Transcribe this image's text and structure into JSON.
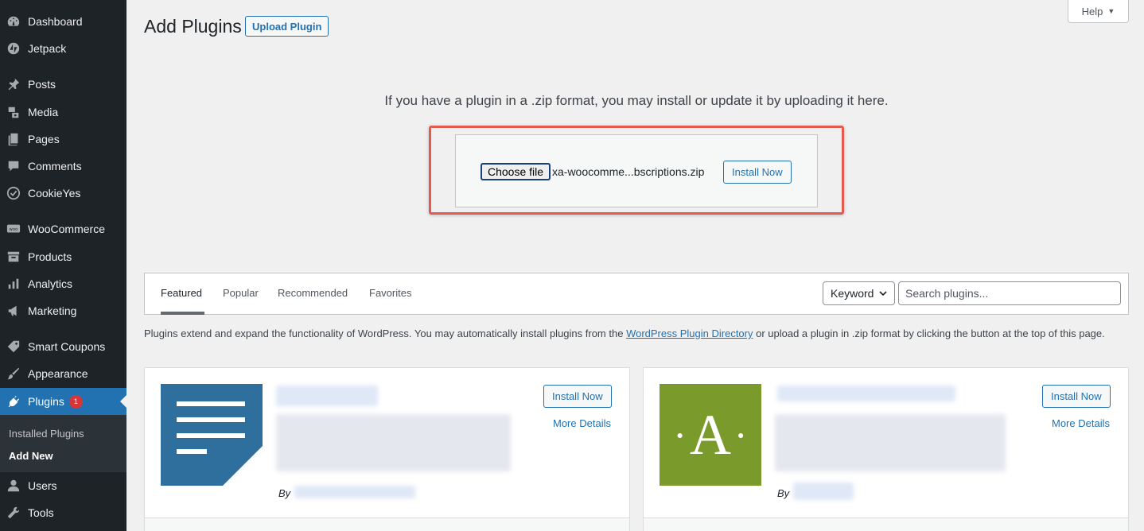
{
  "sidebar": {
    "items": [
      {
        "label": "Dashboard",
        "icon": "dashboard-icon"
      },
      {
        "label": "Jetpack",
        "icon": "jetpack-icon"
      },
      {
        "label": "Posts",
        "icon": "pin-icon"
      },
      {
        "label": "Media",
        "icon": "media-icon"
      },
      {
        "label": "Pages",
        "icon": "pages-icon"
      },
      {
        "label": "Comments",
        "icon": "comment-icon"
      },
      {
        "label": "CookieYes",
        "icon": "cookie-icon"
      },
      {
        "label": "WooCommerce",
        "icon": "woo-icon"
      },
      {
        "label": "Products",
        "icon": "archive-icon"
      },
      {
        "label": "Analytics",
        "icon": "bar-chart-icon"
      },
      {
        "label": "Marketing",
        "icon": "megaphone-icon"
      },
      {
        "label": "Smart Coupons",
        "icon": "tag-icon"
      },
      {
        "label": "Appearance",
        "icon": "brush-icon"
      },
      {
        "label": "Plugins",
        "icon": "plugin-icon",
        "badge": "1"
      },
      {
        "label": "Users",
        "icon": "user-icon"
      },
      {
        "label": "Tools",
        "icon": "wrench-icon"
      }
    ],
    "submenu": [
      {
        "label": "Installed Plugins"
      },
      {
        "label": "Add New"
      }
    ]
  },
  "header": {
    "title": "Add Plugins",
    "upload_label": "Upload Plugin",
    "help_label": "Help"
  },
  "upload": {
    "note": "If you have a plugin in a .zip format, you may install or update it by uploading it here.",
    "choose_file_label": "Choose file",
    "file_name": "xa-woocomme...bscriptions.zip",
    "install_label": "Install Now"
  },
  "filter": {
    "tabs": [
      "Featured",
      "Popular",
      "Recommended",
      "Favorites"
    ],
    "keyword_label": "Keyword",
    "search_placeholder": "Search plugins..."
  },
  "intro": {
    "before": "Plugins extend and expand the functionality of WordPress. You may automatically install plugins from the ",
    "link": "WordPress Plugin Directory",
    "after": " or upload a plugin in .zip format by clicking the button at the top of this page."
  },
  "cards": [
    {
      "install_label": "Install Now",
      "more_details": "More Details",
      "by_label": "By"
    },
    {
      "install_label": "Install Now",
      "more_details": "More Details",
      "by_label": "By",
      "icon_letter": "A"
    }
  ],
  "colors": {
    "sidebar_bg": "#1d2327",
    "accent": "#2271b1",
    "highlight": "#e45a4f",
    "card1_icon_bg": "#2e6f9e",
    "card2_icon_bg": "#7a9a2c"
  }
}
